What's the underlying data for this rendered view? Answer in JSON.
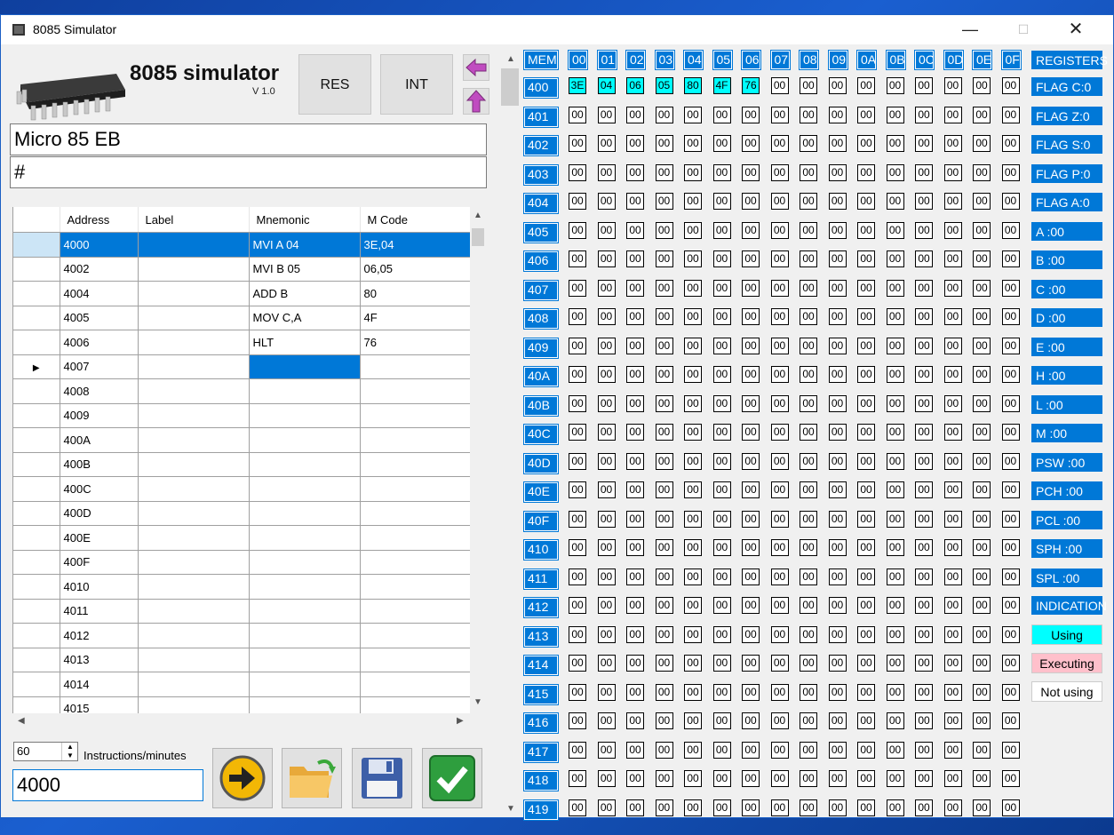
{
  "window": {
    "title": "8085 Simulator"
  },
  "brand": {
    "name": "8085 simulator",
    "version": "V 1.0"
  },
  "buttons": {
    "reset": "RES",
    "interrupt": "INT"
  },
  "device_name": "Micro 85 EB",
  "command_line": "#",
  "program_grid": {
    "columns": [
      "Address",
      "Label",
      "Mnemonic",
      "M Code"
    ],
    "rows": [
      {
        "address": "4000",
        "label": "",
        "mnemonic": "MVI A 04",
        "mcode": "3E,04"
      },
      {
        "address": "4002",
        "label": "",
        "mnemonic": "MVI B 05",
        "mcode": "06,05"
      },
      {
        "address": "4004",
        "label": "",
        "mnemonic": "ADD B",
        "mcode": "80"
      },
      {
        "address": "4005",
        "label": "",
        "mnemonic": "MOV C,A",
        "mcode": "4F"
      },
      {
        "address": "4006",
        "label": "",
        "mnemonic": "HLT",
        "mcode": "76"
      },
      {
        "address": "4007",
        "label": "",
        "mnemonic": "",
        "mcode": ""
      },
      {
        "address": "4008",
        "label": "",
        "mnemonic": "",
        "mcode": ""
      },
      {
        "address": "4009",
        "label": "",
        "mnemonic": "",
        "mcode": ""
      },
      {
        "address": "400A",
        "label": "",
        "mnemonic": "",
        "mcode": ""
      },
      {
        "address": "400B",
        "label": "",
        "mnemonic": "",
        "mcode": ""
      },
      {
        "address": "400C",
        "label": "",
        "mnemonic": "",
        "mcode": ""
      },
      {
        "address": "400D",
        "label": "",
        "mnemonic": "",
        "mcode": ""
      },
      {
        "address": "400E",
        "label": "",
        "mnemonic": "",
        "mcode": ""
      },
      {
        "address": "400F",
        "label": "",
        "mnemonic": "",
        "mcode": ""
      },
      {
        "address": "4010",
        "label": "",
        "mnemonic": "",
        "mcode": ""
      },
      {
        "address": "4011",
        "label": "",
        "mnemonic": "",
        "mcode": ""
      },
      {
        "address": "4012",
        "label": "",
        "mnemonic": "",
        "mcode": ""
      },
      {
        "address": "4013",
        "label": "",
        "mnemonic": "",
        "mcode": ""
      },
      {
        "address": "4014",
        "label": "",
        "mnemonic": "",
        "mcode": ""
      },
      {
        "address": "4015",
        "label": "",
        "mnemonic": "",
        "mcode": ""
      }
    ]
  },
  "speed": {
    "value": "60",
    "label": "Instructions/minutes"
  },
  "start_address": "4000",
  "memory": {
    "corner": "MEM",
    "columns": [
      "00",
      "01",
      "02",
      "03",
      "04",
      "05",
      "06",
      "07",
      "08",
      "09",
      "0A",
      "0B",
      "0C",
      "0D",
      "0E",
      "0F"
    ],
    "rows": [
      "400",
      "401",
      "402",
      "403",
      "404",
      "405",
      "406",
      "407",
      "408",
      "409",
      "40A",
      "40B",
      "40C",
      "40D",
      "40E",
      "40F",
      "410",
      "411",
      "412",
      "413",
      "414",
      "415",
      "416",
      "417",
      "418",
      "419"
    ],
    "first_row_values": [
      "3E",
      "04",
      "06",
      "05",
      "80",
      "4F",
      "76",
      "00",
      "00",
      "00",
      "00",
      "00",
      "00",
      "00",
      "00",
      "00"
    ],
    "default_value": "00"
  },
  "registers": {
    "header": "REGISTERS",
    "items": [
      "FLAG C:0",
      "FLAG Z:0",
      "FLAG S:0",
      "FLAG P:0",
      "FLAG A:0",
      "A :00",
      "B :00",
      "C :00",
      "D :00",
      "E :00",
      "H :00",
      "L :00",
      "M :00",
      "PSW :00",
      "PCH :00",
      "PCL :00",
      "SPH :00",
      "SPL :00"
    ]
  },
  "indication": {
    "header": "INDICATION",
    "using": "Using",
    "executing": "Executing",
    "not_using": "Not using"
  },
  "colors": {
    "accent": "#0078d7",
    "highlight": "#00ffff",
    "executing": "#ffc0cb",
    "desktop": "#1a5fd0"
  }
}
